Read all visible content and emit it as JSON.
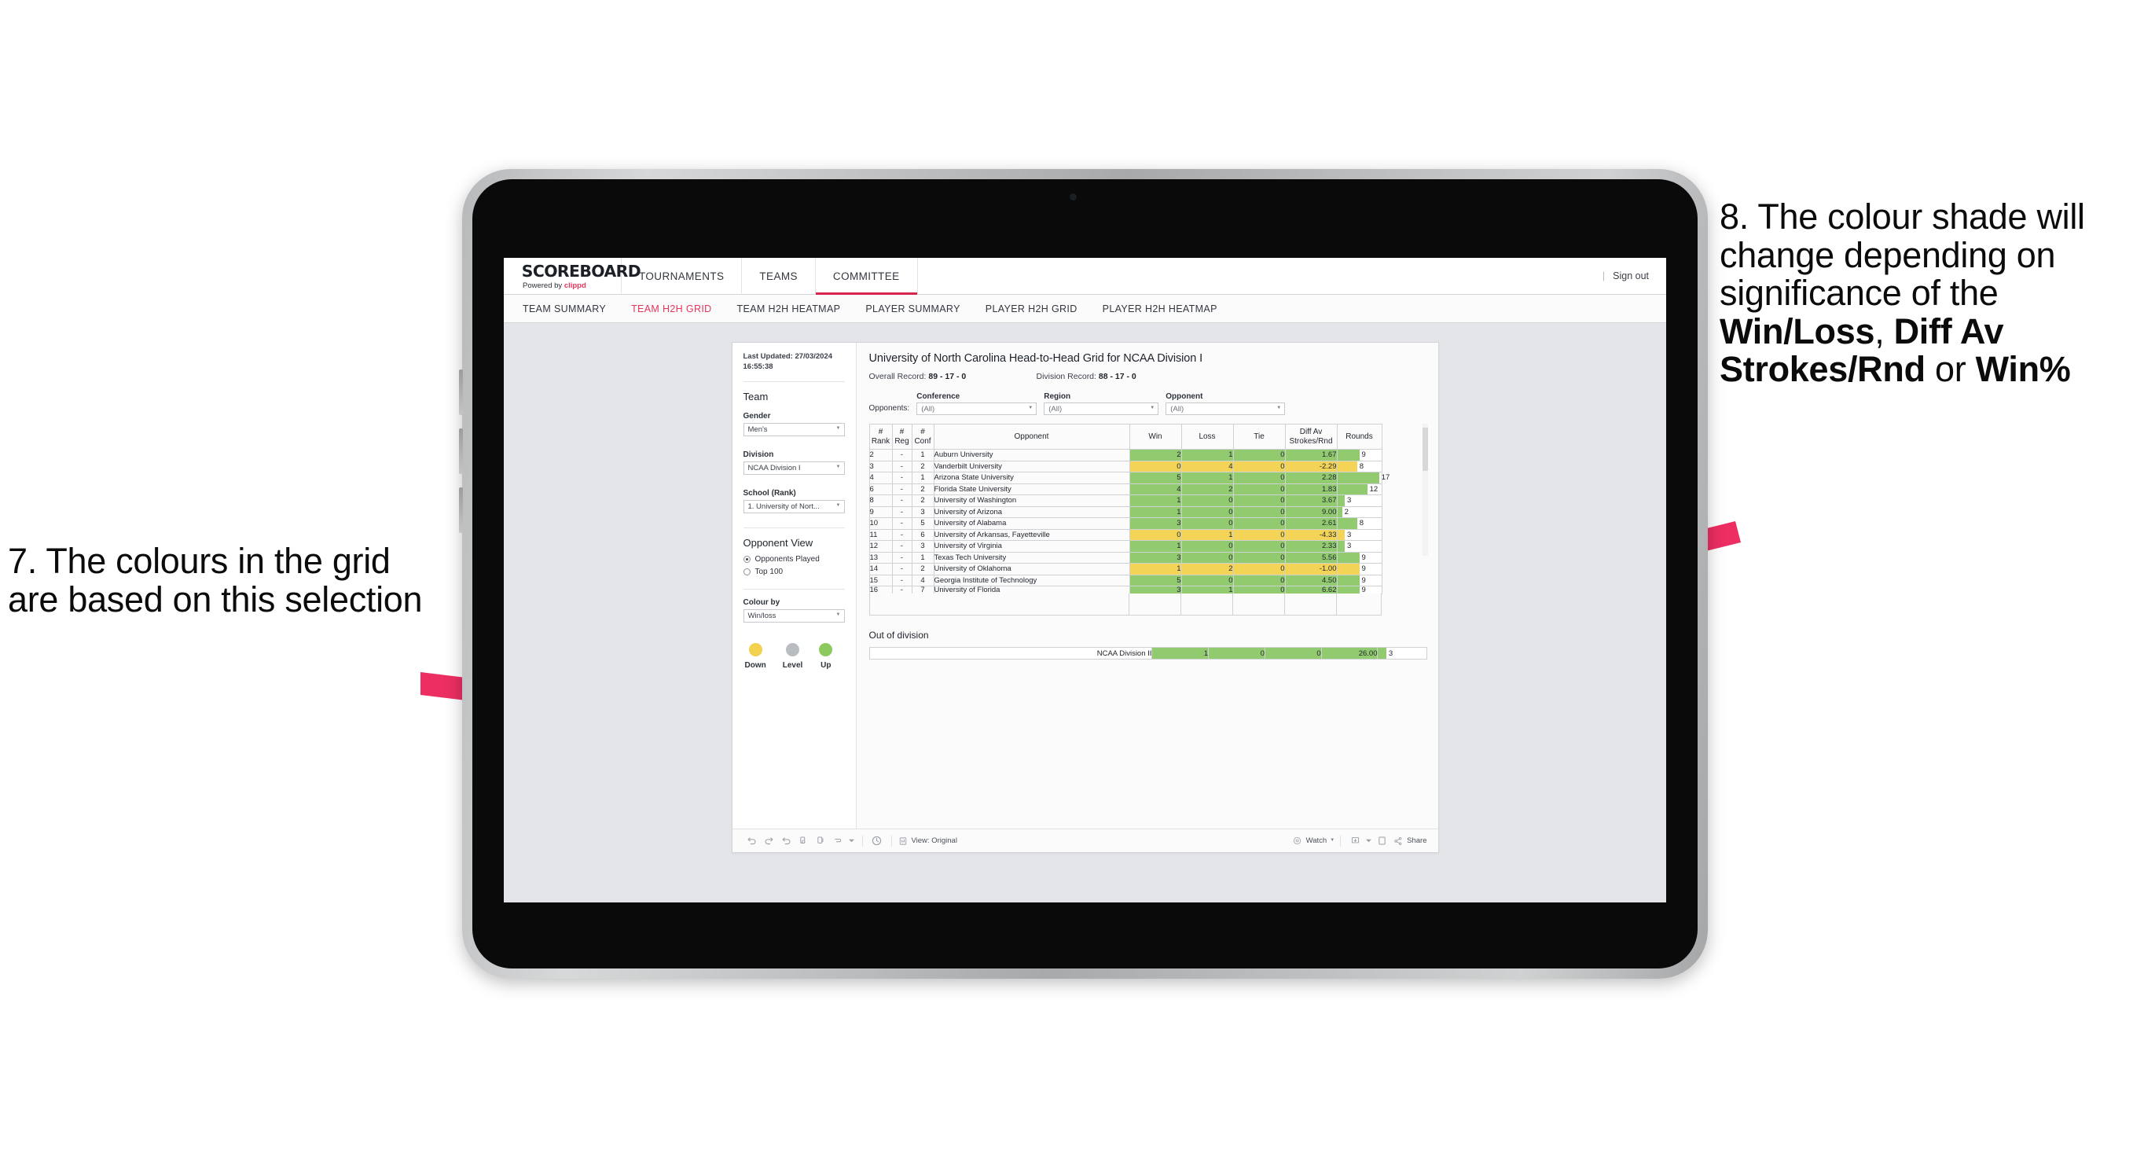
{
  "annotations": {
    "left": {
      "id": "7.",
      "text": "7. The colours in the grid are based on this selection"
    },
    "right": {
      "id": "8.",
      "line1": "8. The colour shade will change depending on significance of the ",
      "bold1": "Win/Loss",
      "mid1": ", ",
      "bold2": "Diff Av Strokes/Rnd",
      "mid2": " or ",
      "bold3": "Win%"
    },
    "arrow_color": "#ED2E63"
  },
  "app": {
    "brand": {
      "title": "SCOREBOARD",
      "powered_prefix": "Powered by ",
      "powered_brand": "clippd"
    },
    "topnav": [
      {
        "label": "TOURNAMENTS",
        "active": false
      },
      {
        "label": "TEAMS",
        "active": false
      },
      {
        "label": "COMMITTEE",
        "active": true
      }
    ],
    "header_right": {
      "separator": "|",
      "signout": "Sign out"
    },
    "subnav": [
      {
        "label": "TEAM SUMMARY",
        "active": false
      },
      {
        "label": "TEAM H2H GRID",
        "active": true
      },
      {
        "label": "TEAM H2H HEATMAP",
        "active": false
      },
      {
        "label": "PLAYER SUMMARY",
        "active": false
      },
      {
        "label": "PLAYER H2H GRID",
        "active": false
      },
      {
        "label": "PLAYER H2H HEATMAP",
        "active": false
      }
    ]
  },
  "sidebar": {
    "last_updated": "Last Updated: 27/03/2024 16:55:38",
    "team_heading": "Team",
    "gender": {
      "label": "Gender",
      "value": "Men's"
    },
    "division": {
      "label": "Division",
      "value": "NCAA Division I"
    },
    "school": {
      "label": "School (Rank)",
      "value": "1. University of Nort..."
    },
    "opponent_view": {
      "heading": "Opponent View",
      "options": [
        {
          "label": "Opponents Played",
          "selected": true
        },
        {
          "label": "Top 100",
          "selected": false
        }
      ]
    },
    "colour_by": {
      "label": "Colour by",
      "value": "Win/loss"
    },
    "legend": [
      {
        "label": "Down",
        "color": "#f2d14f"
      },
      {
        "label": "Level",
        "color": "#b9bcc0"
      },
      {
        "label": "Up",
        "color": "#8cc95f"
      }
    ]
  },
  "main": {
    "title": "University of North Carolina Head-to-Head Grid for NCAA Division I",
    "overall_record_label": "Overall Record: ",
    "overall_record_value": "89 - 17 - 0",
    "division_record_label": "Division Record: ",
    "division_record_value": "88 - 17 - 0",
    "filters": {
      "opponents_label": "Opponents:",
      "conference": {
        "label": "Conference",
        "value": "(All)"
      },
      "region": {
        "label": "Region",
        "value": "(All)"
      },
      "opponent": {
        "label": "Opponent",
        "value": "(All)"
      }
    },
    "table_headers": {
      "rank": "# Rank",
      "rank_l1": "#",
      "rank_l2": "Rank",
      "reg": "# Reg",
      "reg_l1": "#",
      "reg_l2": "Reg",
      "conf": "# Conf",
      "conf_l1": "#",
      "conf_l2": "Conf",
      "opponent": "Opponent",
      "win": "Win",
      "loss": "Loss",
      "tie": "Tie",
      "diff_l1": "Diff Av",
      "diff_l2": "Strokes/Rnd",
      "rounds": "Rounds"
    },
    "out_of_division_title": "Out of division",
    "out_of_division_row": {
      "label": "NCAA Division II",
      "win": "1",
      "loss": "0",
      "tie": "0",
      "diff": "26.00",
      "rounds": "3",
      "color": "g",
      "bar_pct": 100
    }
  },
  "chart_data": {
    "type": "table",
    "title": "University of North Carolina Head-to-Head Grid for NCAA Division I",
    "columns": [
      "# Rank",
      "# Reg",
      "# Conf",
      "Opponent",
      "Win",
      "Loss",
      "Tie",
      "Diff Av Strokes/Rnd",
      "Rounds"
    ],
    "color_legend": {
      "Down": "#f2d14f",
      "Level": "#b9bcc0",
      "Up": "#8cc95f"
    },
    "rounds_axis_max": 17,
    "rows": [
      {
        "rank": "2",
        "reg": "-",
        "conf": "1",
        "opponent": "Auburn University",
        "win": "2",
        "loss": "1",
        "tie": "0",
        "diff": "1.67",
        "rounds": "9",
        "color": "g",
        "bar_pct": 50
      },
      {
        "rank": "3",
        "reg": "-",
        "conf": "2",
        "opponent": "Vanderbilt University",
        "win": "0",
        "loss": "4",
        "tie": "0",
        "diff": "-2.29",
        "rounds": "8",
        "color": "y",
        "bar_pct": 45
      },
      {
        "rank": "4",
        "reg": "-",
        "conf": "1",
        "opponent": "Arizona State University",
        "win": "5",
        "loss": "1",
        "tie": "0",
        "diff": "2.28",
        "rounds": "17",
        "color": "g",
        "bar_pct": 95
      },
      {
        "rank": "6",
        "reg": "-",
        "conf": "2",
        "opponent": "Florida State University",
        "win": "4",
        "loss": "2",
        "tie": "0",
        "diff": "1.83",
        "rounds": "12",
        "color": "g",
        "bar_pct": 68
      },
      {
        "rank": "8",
        "reg": "-",
        "conf": "2",
        "opponent": "University of Washington",
        "win": "1",
        "loss": "0",
        "tie": "0",
        "diff": "3.67",
        "rounds": "3",
        "color": "g",
        "bar_pct": 17
      },
      {
        "rank": "9",
        "reg": "-",
        "conf": "3",
        "opponent": "University of Arizona",
        "win": "1",
        "loss": "0",
        "tie": "0",
        "diff": "9.00",
        "rounds": "2",
        "color": "g",
        "bar_pct": 11
      },
      {
        "rank": "10",
        "reg": "-",
        "conf": "5",
        "opponent": "University of Alabama",
        "win": "3",
        "loss": "0",
        "tie": "0",
        "diff": "2.61",
        "rounds": "8",
        "color": "g",
        "bar_pct": 45
      },
      {
        "rank": "11",
        "reg": "-",
        "conf": "6",
        "opponent": "University of Arkansas, Fayetteville",
        "win": "0",
        "loss": "1",
        "tie": "0",
        "diff": "-4.33",
        "rounds": "3",
        "color": "y",
        "bar_pct": 17
      },
      {
        "rank": "12",
        "reg": "-",
        "conf": "3",
        "opponent": "University of Virginia",
        "win": "1",
        "loss": "0",
        "tie": "0",
        "diff": "2.33",
        "rounds": "3",
        "color": "g",
        "bar_pct": 17
      },
      {
        "rank": "13",
        "reg": "-",
        "conf": "1",
        "opponent": "Texas Tech University",
        "win": "3",
        "loss": "0",
        "tie": "0",
        "diff": "5.56",
        "rounds": "9",
        "color": "g",
        "bar_pct": 50
      },
      {
        "rank": "14",
        "reg": "-",
        "conf": "2",
        "opponent": "University of Oklahoma",
        "win": "1",
        "loss": "2",
        "tie": "0",
        "diff": "-1.00",
        "rounds": "9",
        "color": "y",
        "bar_pct": 50
      },
      {
        "rank": "15",
        "reg": "-",
        "conf": "4",
        "opponent": "Georgia Institute of Technology",
        "win": "5",
        "loss": "0",
        "tie": "0",
        "diff": "4.50",
        "rounds": "9",
        "color": "g",
        "bar_pct": 50
      },
      {
        "rank": "16",
        "reg": "-",
        "conf": "7",
        "opponent": "University of Florida",
        "win": "3",
        "loss": "1",
        "tie": "0",
        "diff": "6.62",
        "rounds": "9",
        "color": "g",
        "bar_pct": 50
      }
    ]
  },
  "toolbar": {
    "view_label": "View: Original",
    "watch_label": "Watch",
    "share_label": "Share"
  }
}
